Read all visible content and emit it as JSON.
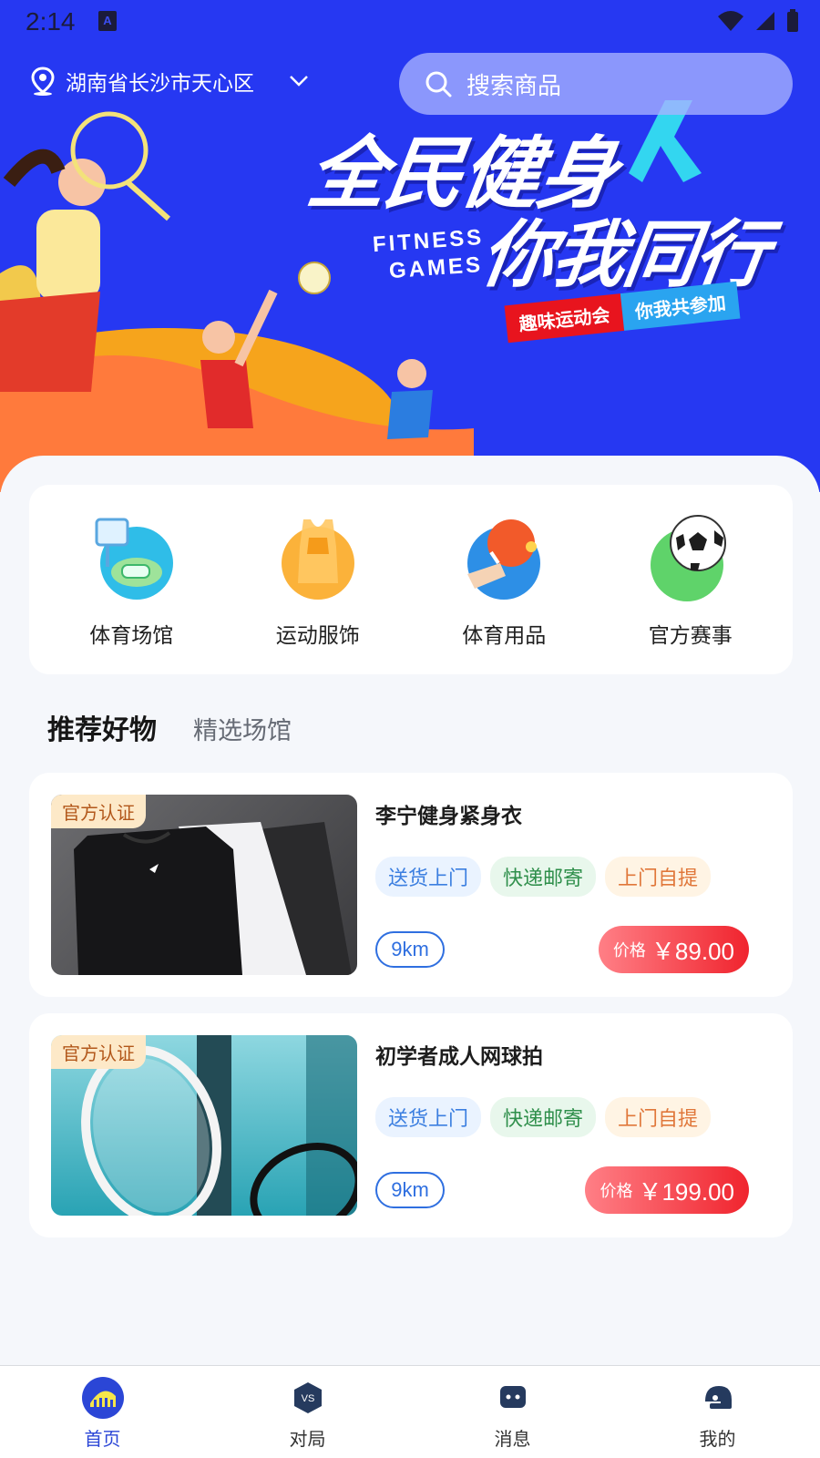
{
  "status_bar": {
    "time": "2:14"
  },
  "header": {
    "location": "湖南省长沙市天心区",
    "search_placeholder": "搜索商品"
  },
  "banner": {
    "title_line1": "全民健身",
    "title_line2": "你我同行",
    "en_line1": "FITNESS",
    "en_line2": "GAMES",
    "tag_left": "趣味运动会",
    "tag_right": "你我共参加"
  },
  "categories": [
    {
      "label": "体育场馆",
      "icon": "basketball-court-icon"
    },
    {
      "label": "运动服饰",
      "icon": "sports-vest-icon"
    },
    {
      "label": "体育用品",
      "icon": "ping-pong-icon"
    },
    {
      "label": "官方赛事",
      "icon": "soccer-ball-icon"
    }
  ],
  "section_tabs": {
    "active": "推荐好物",
    "inactive": "精选场馆"
  },
  "products": [
    {
      "badge": "官方认证",
      "name": "李宁健身紧身衣",
      "tags": [
        "送货上门",
        "快递邮寄",
        "上门自提"
      ],
      "distance": "9km",
      "price_label": "价格",
      "price": "￥89.00"
    },
    {
      "badge": "官方认证",
      "name": "初学者成人网球拍",
      "tags": [
        "送货上门",
        "快递邮寄",
        "上门自提"
      ],
      "distance": "9km",
      "price_label": "价格",
      "price": "￥199.00"
    }
  ],
  "bottom_nav": [
    {
      "label": "首页",
      "icon": "home-stadium-icon",
      "active": true
    },
    {
      "label": "对局",
      "icon": "vs-icon",
      "active": false
    },
    {
      "label": "消息",
      "icon": "message-icon",
      "active": false
    },
    {
      "label": "我的",
      "icon": "helmet-icon",
      "active": false
    }
  ],
  "colors": {
    "banner_blue": "#2638f2",
    "accent_blue": "#2b46d6",
    "price_red": "#f0242e"
  }
}
